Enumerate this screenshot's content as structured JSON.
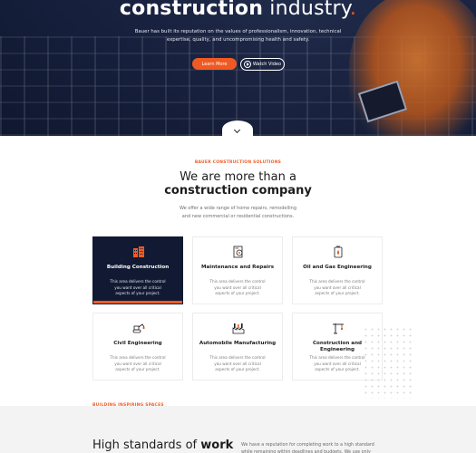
{
  "hero": {
    "title_light": "construction",
    "title_rest": " industry",
    "title_dot": ".",
    "description": "Bauer has built its reputation on the values of professionalism, innovation, technical expertise, quality, and uncompromising health and safety.",
    "primary_button": "Learn More",
    "secondary_button": "Watch Video"
  },
  "services": {
    "eyebrow": "BAUER CONSTRUCTION SOLUTIONS",
    "heading_line1": "We are more than a",
    "heading_line2": "construction company",
    "intro": "We offer a wide range of home repairs, remodelling and new commercial or residential constructions.",
    "cards": [
      {
        "title": "Building Construction",
        "desc": "This area delivers the control you want over all critical aspects of your project.",
        "icon": "building-icon"
      },
      {
        "title": "Maintenance and Repairs",
        "desc": "This area delivers the control you want over all critical aspects of your project.",
        "icon": "maintenance-icon"
      },
      {
        "title": "Oil and Gas Engineering",
        "desc": "This area delivers the control you want over all critical aspects of your project.",
        "icon": "oil-gas-icon"
      },
      {
        "title": "Civil Engineering",
        "desc": "This area delivers the control you want over all critical aspects of your project.",
        "icon": "excavator-icon"
      },
      {
        "title": "Automobile Manufacturing",
        "desc": "This area delivers the control you want over all critical aspects of your project.",
        "icon": "factory-icon"
      },
      {
        "title": "Construction and Engineering",
        "desc": "This area delivers the control you want over all critical aspects of your project.",
        "icon": "crane-icon"
      }
    ]
  },
  "next_section": {
    "eyebrow": "BUILDING INSPIRING SPACES",
    "heading_light": "High standards of ",
    "heading_bold": "work",
    "text": "We have a reputation for completing work to a high standard while remaining within deadlines and budgets. We use only"
  },
  "colors": {
    "accent": "#f05a22",
    "navy": "#121a33"
  }
}
